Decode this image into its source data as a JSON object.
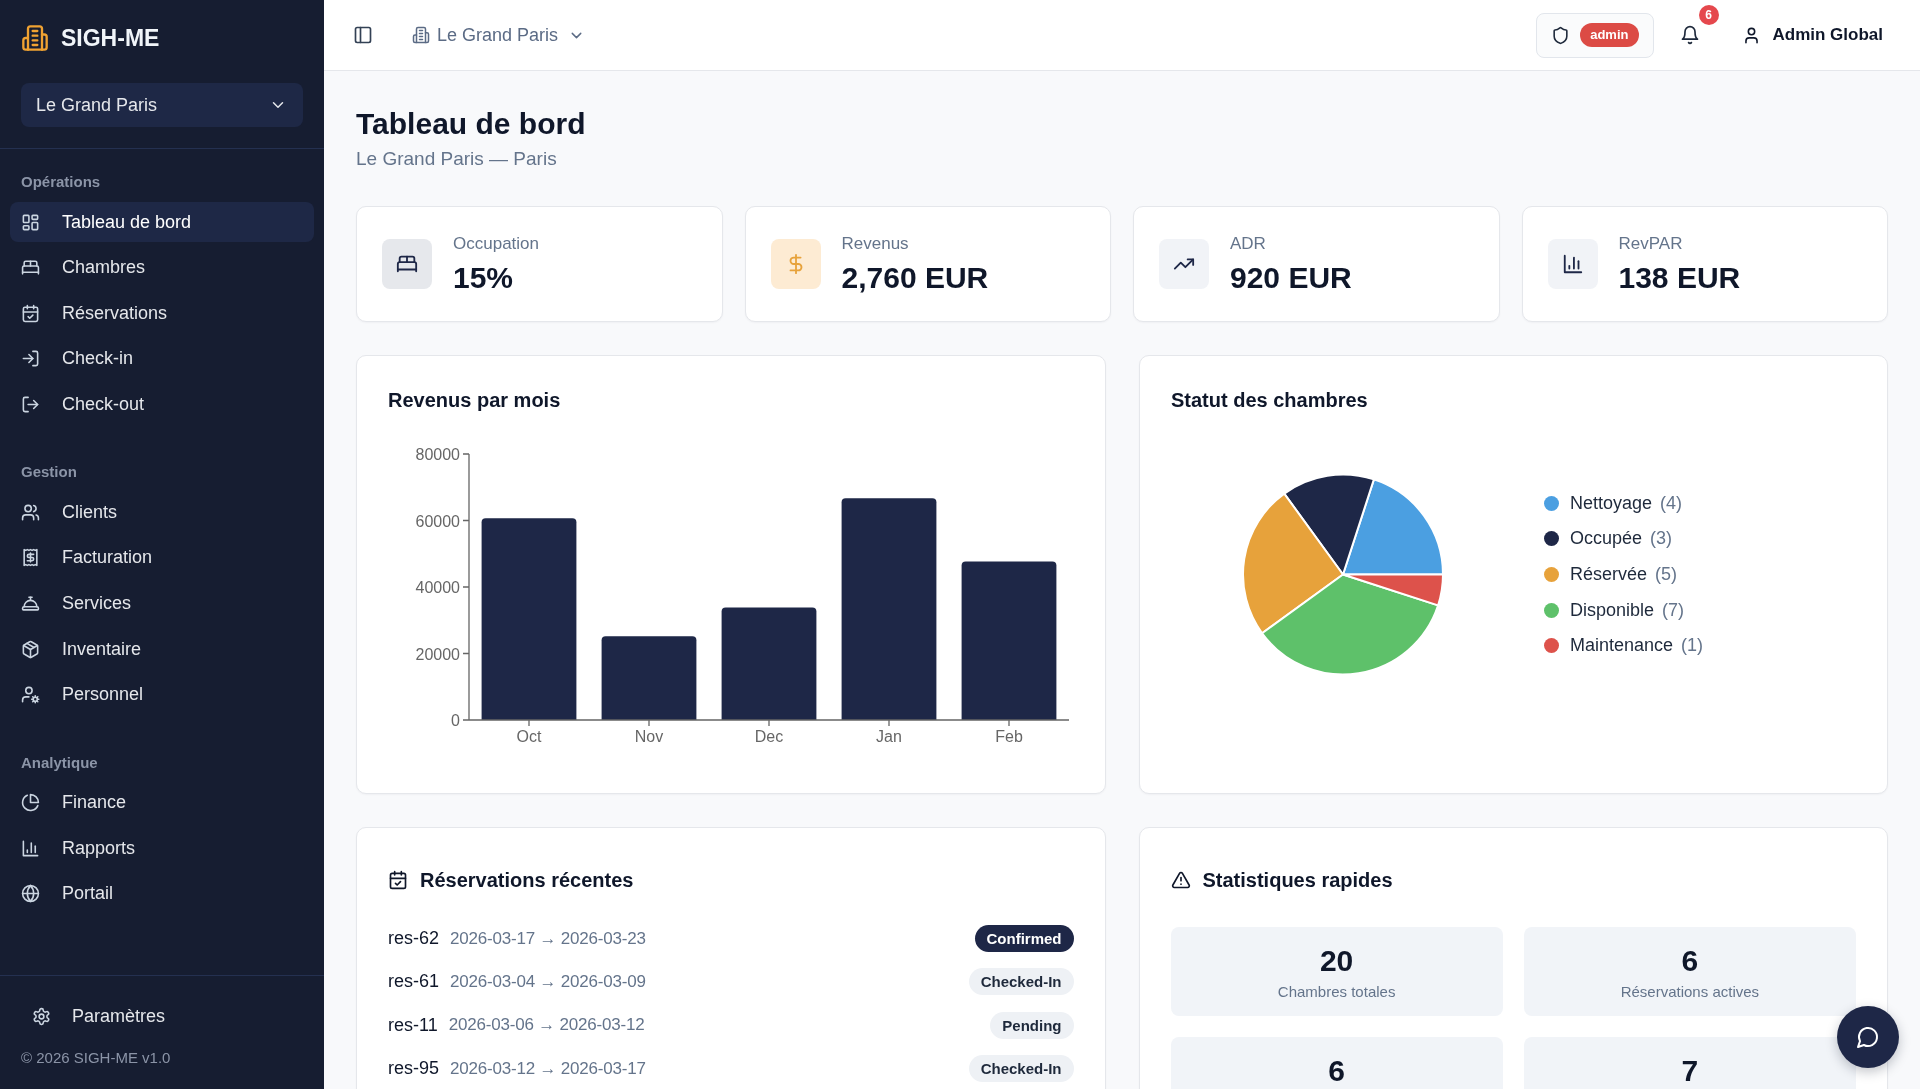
{
  "sidebar": {
    "brand": "SIGH-ME",
    "hotel_select": {
      "value": "Le Grand Paris"
    },
    "sections": [
      {
        "title": "Opérations",
        "items": [
          {
            "label": "Tableau de bord",
            "selected": true
          },
          {
            "label": "Chambres",
            "selected": false
          },
          {
            "label": "Réservations",
            "selected": false
          },
          {
            "label": "Check-in",
            "selected": false
          },
          {
            "label": "Check-out",
            "selected": false
          }
        ]
      },
      {
        "title": "Gestion",
        "items": [
          {
            "label": "Clients",
            "selected": false
          },
          {
            "label": "Facturation",
            "selected": false
          },
          {
            "label": "Services",
            "selected": false
          },
          {
            "label": "Inventaire",
            "selected": false
          },
          {
            "label": "Personnel",
            "selected": false
          }
        ]
      },
      {
        "title": "Analytique",
        "items": [
          {
            "label": "Finance",
            "selected": false
          },
          {
            "label": "Rapports",
            "selected": false
          },
          {
            "label": "Portail",
            "selected": false
          }
        ]
      }
    ],
    "settings_link": "Paramètres",
    "copyright": "© 2026 SIGH-ME v1.0"
  },
  "top_bar": {
    "hotel_switcher": "Le Grand Paris",
    "role_badge": "admin",
    "notification_count": "6",
    "user_name": "Admin Global"
  },
  "page_header": {
    "title": "Tableau de bord",
    "subtitle": "Le Grand Paris — Paris"
  },
  "kpi_cards": [
    {
      "kind": "occupancy",
      "label": "Occupation",
      "value": "15%"
    },
    {
      "kind": "revenue",
      "label": "Revenus",
      "value": "2,760 EUR"
    },
    {
      "kind": "adr",
      "label": "ADR",
      "value": "920 EUR"
    },
    {
      "kind": "revpar",
      "label": "RevPAR",
      "value": "138 EUR"
    }
  ],
  "revenue_chart": {
    "chart_data": {
      "type": "bar",
      "title": "Revenus par mois",
      "categories": [
        "Oct",
        "Nov",
        "Dec",
        "Jan",
        "Feb"
      ],
      "values": [
        60700,
        25200,
        33800,
        66700,
        47700
      ],
      "ylim": [
        0,
        80000
      ],
      "yticks": [
        0,
        20000,
        40000,
        60000,
        80000
      ]
    }
  },
  "room_status": {
    "chart_data": {
      "type": "pie",
      "title": "Statut des chambres",
      "categories": [
        "Nettoyage",
        "Occupée",
        "Réservée",
        "Disponible",
        "Maintenance"
      ],
      "values": [
        20,
        15,
        25,
        35,
        5
      ],
      "legend": "right"
    },
    "legend_items": [
      {
        "count": "(4)",
        "color": "#4b9fe1"
      },
      {
        "count": "(3)",
        "color": "#1e2747"
      },
      {
        "count": "(5)",
        "color": "#e7a23b"
      },
      {
        "count": "(7)",
        "color": "#5ec16a"
      },
      {
        "count": "(1)",
        "color": "#dd524b"
      }
    ]
  },
  "recent_reservations": {
    "title": "Réservations récentes",
    "rows": [
      {
        "id": "res-62",
        "dates": "2026-03-17 → 2026-03-23",
        "status": "Confirmed",
        "kind": "confirmed"
      },
      {
        "id": "res-61",
        "dates": "2026-03-04 → 2026-03-09",
        "status": "Checked-In",
        "kind": "checked_in"
      },
      {
        "id": "res-11",
        "dates": "2026-03-06 → 2026-03-12",
        "status": "Pending",
        "kind": "pending"
      },
      {
        "id": "res-95",
        "dates": "2026-03-12 → 2026-03-17",
        "status": "Checked-In",
        "kind": "checked_in"
      }
    ]
  },
  "quick_stats": {
    "title": "Statistiques rapides",
    "tiles": [
      {
        "value": "20",
        "label": "Chambres totales"
      },
      {
        "value": "6",
        "label": "Réservations actives"
      },
      {
        "value": "6"
      },
      {
        "value": "7"
      }
    ]
  }
}
